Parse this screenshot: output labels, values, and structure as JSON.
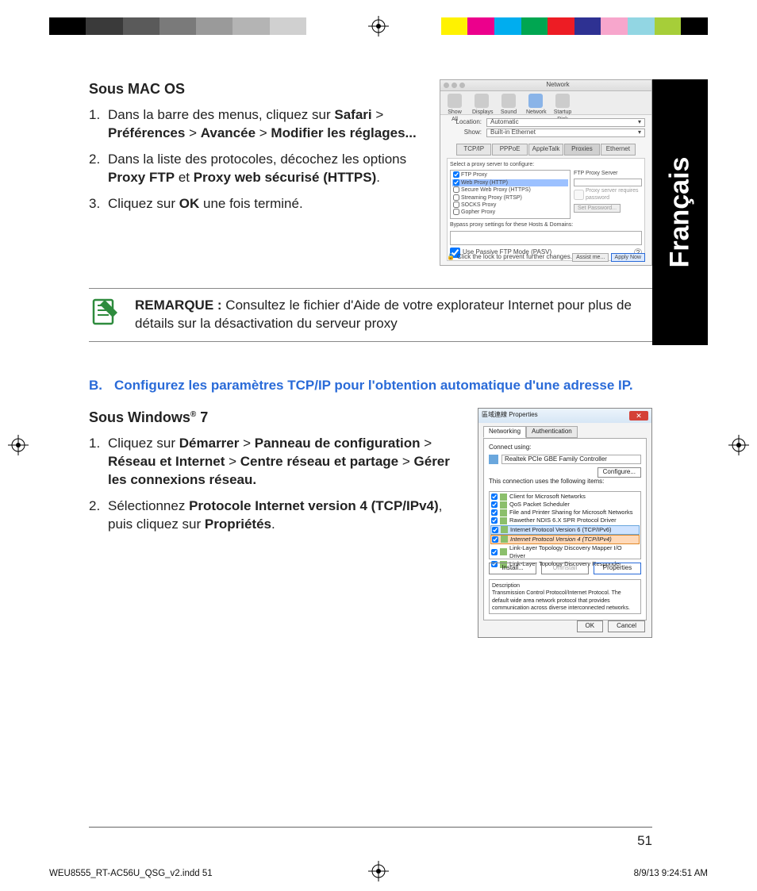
{
  "colorbar": {
    "left_grays": [
      "#000000",
      "#3a3a3a",
      "#5a5a5a",
      "#7a7a7a",
      "#9a9a9a",
      "#b4b4b4",
      "#d0d0d0",
      "#ffffff"
    ],
    "right_colors": [
      "#ffffff",
      "#fff200",
      "#ec008c",
      "#00adef",
      "#00a651",
      "#ed1c24",
      "#2e3192",
      "#f7a6cc",
      "#92d6e3",
      "#a6ce39",
      "#000000"
    ]
  },
  "language_tab": "Français",
  "macos": {
    "heading": "Sous MAC OS",
    "step1_a": "Dans la barre des menus, cliquez sur ",
    "step1_b": "Safari",
    "step1_c": " > ",
    "step1_d": "Préférences",
    "step1_e": " > ",
    "step1_f": "Avancée",
    "step1_g": " > ",
    "step1_h": "Modifier les réglages...",
    "step2_a": "Dans la liste des protocoles, décochez les options ",
    "step2_b": "Proxy FTP",
    "step2_c": " et ",
    "step2_d": "Proxy web sécurisé (HTTPS)",
    "step2_e": ".",
    "step3_a": "Cliquez sur ",
    "step3_b": "OK",
    "step3_c": " une fois terminé."
  },
  "macshot": {
    "title": "Network",
    "toolbar": [
      "Show All",
      "Displays",
      "Sound",
      "Network",
      "Startup Disk"
    ],
    "location_lbl": "Location:",
    "location_val": "Automatic",
    "show_lbl": "Show:",
    "show_val": "Built-in Ethernet",
    "tabs": [
      "TCP/IP",
      "PPPoE",
      "AppleTalk",
      "Proxies",
      "Ethernet"
    ],
    "active_tab": 3,
    "select_label": "Select a proxy server to configure:",
    "proxies": [
      "FTP Proxy",
      "Web Proxy (HTTP)",
      "Secure Web Proxy (HTTPS)",
      "Streaming Proxy (RTSP)",
      "SOCKS Proxy",
      "Gopher Proxy"
    ],
    "ftp_server_lbl": "FTP Proxy Server",
    "requires_pw": "Proxy server requires password",
    "set_pw": "Set Password...",
    "bypass_lbl": "Bypass proxy settings for these Hosts & Domains:",
    "pasv": "Use Passive FTP Mode (PASV)",
    "lock": "Click the lock to prevent further changes.",
    "assist": "Assist me...",
    "apply": "Apply Now"
  },
  "note": {
    "label": "REMARQUE :",
    "text": " Consultez le fichier d'Aide de votre explorateur Internet pour plus de détails sur la désactivation du serveur proxy"
  },
  "sectionB": {
    "letter": "B.",
    "title": "Configurez les paramètres TCP/IP pour l'obtention automatique d'une adresse IP."
  },
  "win7": {
    "heading_a": "Sous Windows",
    "heading_b": " 7",
    "step1_a": "Cliquez sur ",
    "step1_b": "Démarrer",
    "step1_c": " > ",
    "step1_d": "Panneau de configuration",
    "step1_e": " > ",
    "step1_f": "Réseau et Internet",
    "step1_g": " > ",
    "step1_h": "Centre réseau et partage",
    "step1_i": " > ",
    "step1_j": "Gérer les connexions réseau.",
    "step2_a": "Sélectionnez ",
    "step2_b": "Protocole Internet version 4 (TCP/IPv4)",
    "step2_c": ", puis cliquez sur ",
    "step2_d": "Propriétés",
    "step2_e": "."
  },
  "winshot": {
    "title": "區域連線 Properties",
    "tabs": [
      "Networking",
      "Authentication"
    ],
    "connect_using": "Connect using:",
    "adapter": "Realtek PCIe GBE Family Controller",
    "configure": "Configure...",
    "uses_items": "This connection uses the following items:",
    "items": [
      "Client for Microsoft Networks",
      "QoS Packet Scheduler",
      "File and Printer Sharing for Microsoft Networks",
      "Rawether NDIS 6.X SPR Protocol Driver",
      "Internet Protocol Version 6 (TCP/IPv6)",
      "Internet Protocol Version 4 (TCP/IPv4)",
      "Link-Layer Topology Discovery Mapper I/O Driver",
      "Link-Layer Topology Discovery Responder"
    ],
    "install": "Install...",
    "uninstall": "Uninstall",
    "properties": "Properties",
    "desc_lbl": "Description",
    "desc_txt": "Transmission Control Protocol/Internet Protocol. The default wide area network protocol that provides communication across diverse interconnected networks.",
    "ok": "OK",
    "cancel": "Cancel"
  },
  "page_number": "51",
  "slug_left": "WEU8555_RT-AC56U_QSG_v2.indd   51",
  "slug_right": "8/9/13   9:24:51 AM"
}
